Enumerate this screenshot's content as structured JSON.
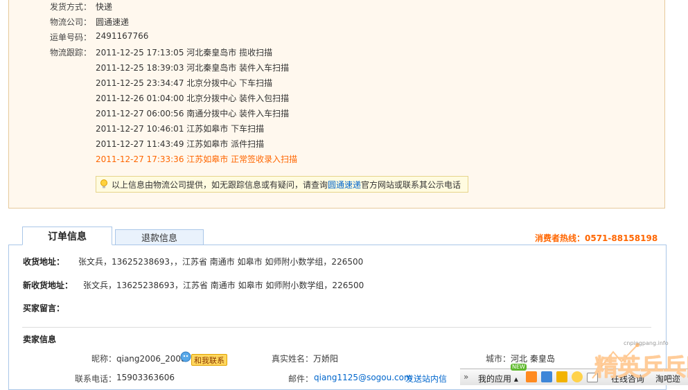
{
  "shipping": {
    "method_label": "发货方式：",
    "method_value": "快递",
    "company_label": "物流公司：",
    "company_value": "圆通速递",
    "tracking_no_label": "运单号码：",
    "tracking_no_value": "2491167766",
    "tracking_label": "物流跟踪：",
    "events": [
      "2011-12-25 17:13:05 河北秦皇岛市 揽收扫描",
      "2011-12-25 18:39:03 河北秦皇岛市 装件入车扫描",
      "2011-12-25 23:34:47 北京分拨中心 下车扫描",
      "2011-12-26 01:04:00 北京分拨中心 装件入包扫描",
      "2011-12-27 06:00:56 南通分拨中心 装件入车扫描",
      "2011-12-27 10:46:01 江苏如皋市 下车扫描",
      "2011-12-27 11:43:49 江苏如皋市 派件扫描",
      "2011-12-27 17:33:36 江苏如皋市 正常签收录入扫描"
    ],
    "tip_prefix": "以上信息由物流公司提供，如无跟踪信息或有疑问，请查询",
    "tip_link": "圆通速递",
    "tip_suffix": "官方网站或联系其公示电话"
  },
  "tabs": {
    "order": "订单信息",
    "refund": "退款信息"
  },
  "hotline": "消费者热线：0571-88158198",
  "order": {
    "address_label": "收货地址：",
    "address_value": "张文兵，13625238693，，江苏省 南通市 如皋市 如师附小数学组，226500",
    "new_address_label": "新收货地址：",
    "new_address_value": "张文兵，13625238693，江苏省 南通市 如皋市 如师附小数学组，226500",
    "buyer_msg_label": "买家留言："
  },
  "seller": {
    "section_title": "卖家信息",
    "nick_label": "昵称：",
    "nick_value": "qiang2006_2008",
    "contact_btn": "和我联系",
    "realname_label": "真实姓名：",
    "realname_value": "万娇阳",
    "city_label": "城市：",
    "city_value": "河北 秦皇岛",
    "phone_label": "联系电话：",
    "phone_value": "15903363606",
    "email_label": "邮件：",
    "email_value": "qiang1125@sogou.com",
    "message_link": "发送站内信"
  },
  "appbar": {
    "my_apps": "我的应用",
    "new_badge": "NEW",
    "online": "在线咨询",
    "taoba": "淘吧迩"
  },
  "watermark": {
    "url": "cnpingpang.info",
    "text": "精英乒乓网"
  },
  "colors": {
    "accent": "#ff6600",
    "link": "#0066cc",
    "panel_bg": "#fff8ee",
    "tab_border": "#a9c6e8"
  }
}
